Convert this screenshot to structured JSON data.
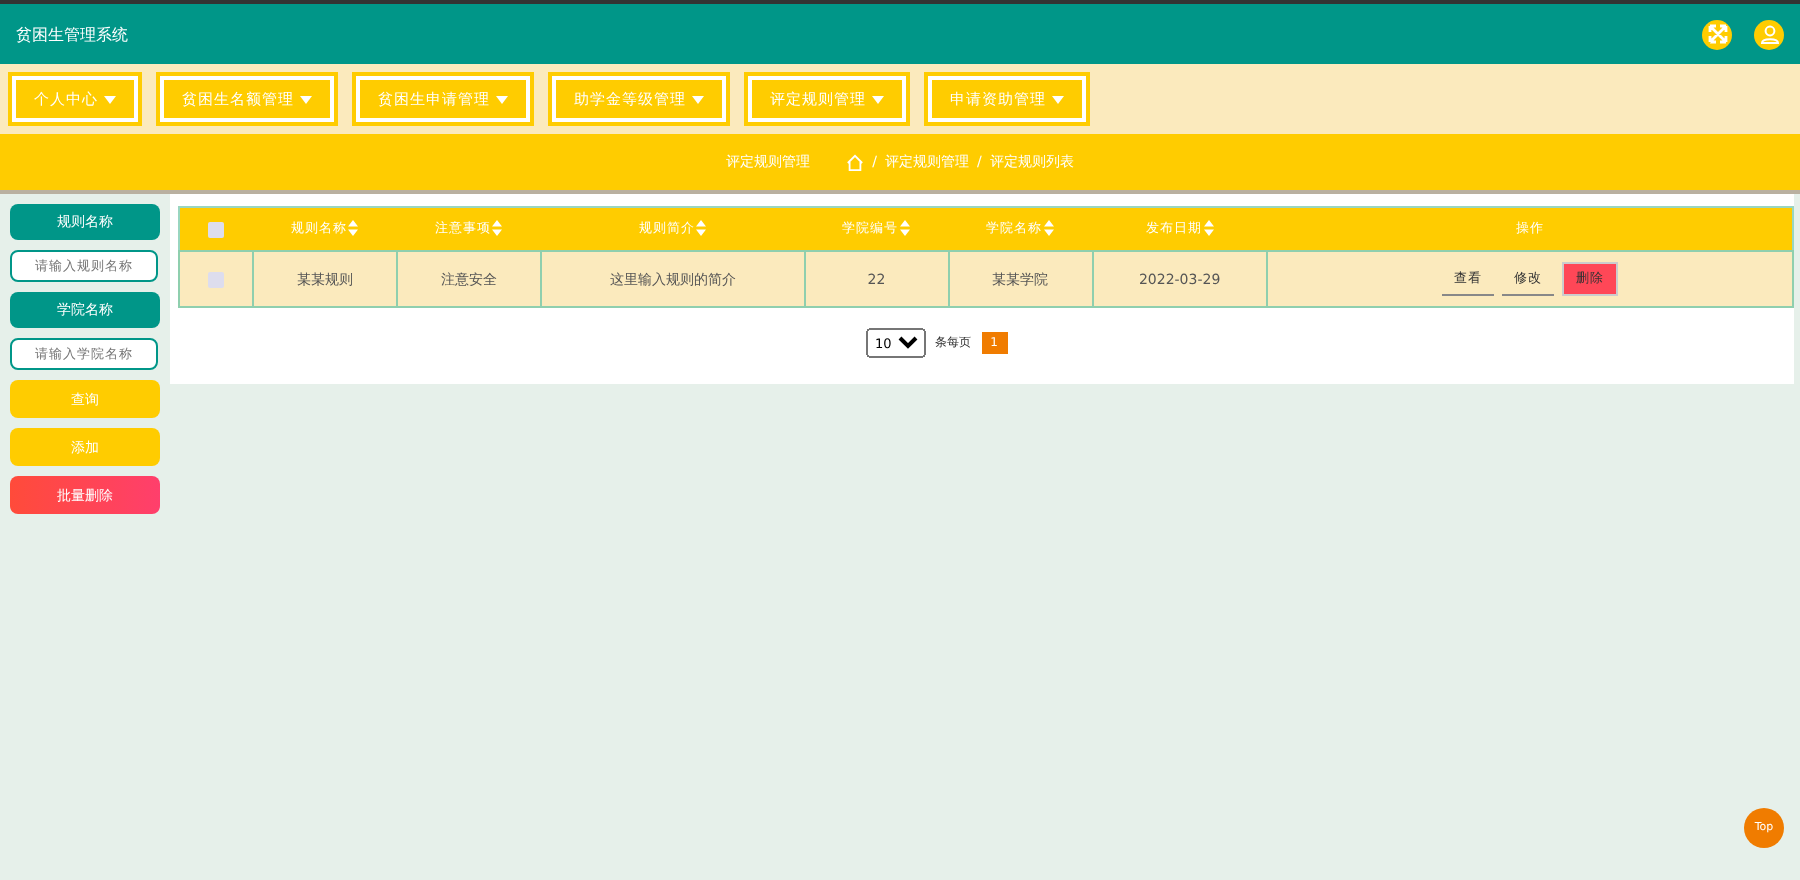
{
  "header": {
    "title": "贫困生管理系统"
  },
  "nav": [
    {
      "label": "个人中心"
    },
    {
      "label": "贫困生名额管理"
    },
    {
      "label": "贫困生申请管理"
    },
    {
      "label": "助学金等级管理"
    },
    {
      "label": "评定规则管理"
    },
    {
      "label": "申请资助管理"
    }
  ],
  "breadcrumb": {
    "title": "评定规则管理",
    "separator": "/",
    "path": [
      "评定规则管理",
      "评定规则列表"
    ]
  },
  "sidebar": [
    {
      "kind": "label",
      "text": "规则名称"
    },
    {
      "kind": "field",
      "placeholder": "请输入规则名称"
    },
    {
      "kind": "label",
      "text": "学院名称"
    },
    {
      "kind": "field",
      "placeholder": "请输入学院名称"
    },
    {
      "kind": "button",
      "text": "查询"
    },
    {
      "kind": "button",
      "text": "添加"
    },
    {
      "kind": "danger",
      "text": "批量删除"
    }
  ],
  "table": {
    "select_all_checked": false,
    "columns": [
      {
        "label": "规则名称",
        "sortable": true
      },
      {
        "label": "注意事项",
        "sortable": true
      },
      {
        "label": "规则简介",
        "sortable": true
      },
      {
        "label": "学院编号",
        "sortable": true
      },
      {
        "label": "学院名称",
        "sortable": true
      },
      {
        "label": "发布日期",
        "sortable": true
      },
      {
        "label": "操作",
        "sortable": false
      }
    ],
    "rows": [
      {
        "checked": false,
        "cells": [
          "某某规则",
          "注意安全",
          "这里输入规则的简介",
          "22",
          "某某学院",
          "2022-03-29"
        ],
        "actions": [
          {
            "kind": "plain",
            "label": "查看"
          },
          {
            "kind": "plain",
            "label": "修改"
          },
          {
            "kind": "danger",
            "label": "删除"
          }
        ]
      }
    ]
  },
  "pagination": {
    "page_size": "10",
    "page_size_label": "条每页",
    "pages": [
      {
        "label": "1",
        "selected": true
      }
    ]
  },
  "top_button": {
    "label": "Top"
  }
}
